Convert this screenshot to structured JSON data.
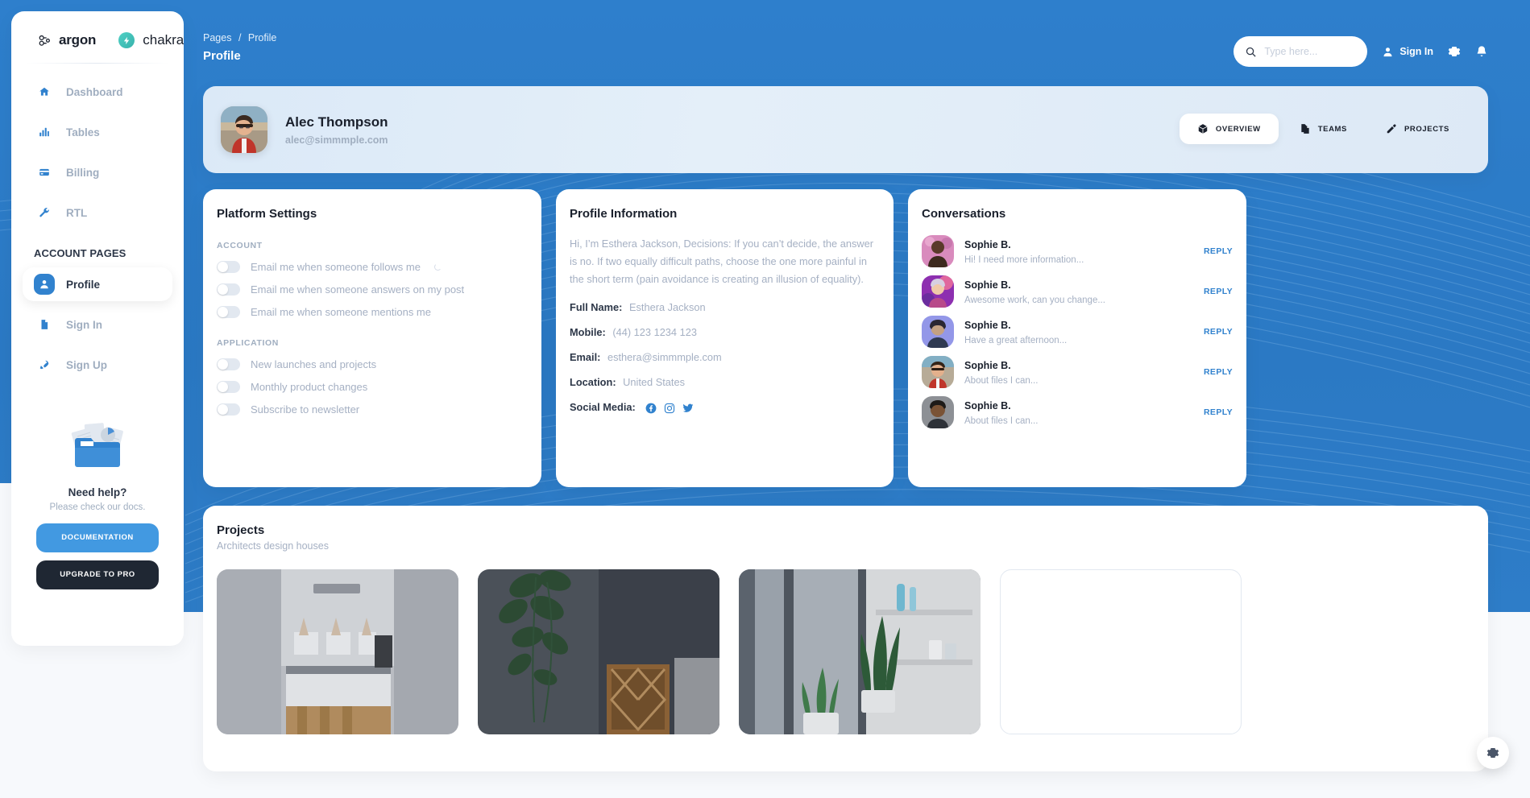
{
  "brand": {
    "name": "argon",
    "sub": "chakra"
  },
  "sidebar": {
    "items": [
      {
        "label": "Dashboard",
        "icon": "home-icon",
        "active": false
      },
      {
        "label": "Tables",
        "icon": "chart-bars-icon",
        "active": false
      },
      {
        "label": "Billing",
        "icon": "credit-card-icon",
        "active": false
      },
      {
        "label": "RTL",
        "icon": "wrench-icon",
        "active": false
      }
    ],
    "section_label": "ACCOUNT PAGES",
    "account_items": [
      {
        "label": "Profile",
        "icon": "person-icon",
        "active": true
      },
      {
        "label": "Sign In",
        "icon": "document-icon",
        "active": false
      },
      {
        "label": "Sign Up",
        "icon": "rocket-icon",
        "active": false
      }
    ],
    "help": {
      "title": "Need help?",
      "subtitle": "Please check our docs.",
      "doc_button": "DOCUMENTATION",
      "pro_button": "UPGRADE TO PRO"
    }
  },
  "topbar": {
    "breadcrumb_parent": "Pages",
    "breadcrumb_sep": "/",
    "breadcrumb_current": "Profile",
    "page_title": "Profile",
    "search_placeholder": "Type here...",
    "search_value": "",
    "sign_in": "Sign In",
    "icons": [
      "search-icon",
      "person-icon",
      "gear-icon",
      "bell-icon"
    ]
  },
  "profile_header": {
    "name": "Alec Thompson",
    "email": "alec@simmmple.com",
    "tabs": [
      {
        "label": "OVERVIEW",
        "icon": "cube-icon",
        "active": true
      },
      {
        "label": "TEAMS",
        "icon": "documents-icon",
        "active": false
      },
      {
        "label": "PROJECTS",
        "icon": "pen-icon",
        "active": false
      }
    ]
  },
  "platform_settings": {
    "title": "Platform Settings",
    "groups": [
      {
        "label": "ACCOUNT",
        "items": [
          {
            "label": "Email me when someone follows me",
            "on": false,
            "spinner": true
          },
          {
            "label": "Email me when someone answers on my post",
            "on": false,
            "spinner": false
          },
          {
            "label": "Email me when someone mentions me",
            "on": false,
            "spinner": false
          }
        ]
      },
      {
        "label": "APPLICATION",
        "items": [
          {
            "label": "New launches and projects",
            "on": false,
            "spinner": false
          },
          {
            "label": "Monthly product changes",
            "on": false,
            "spinner": false
          },
          {
            "label": "Subscribe to newsletter",
            "on": false,
            "spinner": false
          }
        ]
      }
    ]
  },
  "profile_information": {
    "title": "Profile Information",
    "bio": "Hi, I’m Esthera Jackson, Decisions: If you can’t decide, the answer is no. If two equally difficult paths, choose the one more painful in the short term (pain avoidance is creating an illusion of equality).",
    "fields": [
      {
        "key": "Full Name:",
        "value": "Esthera Jackson"
      },
      {
        "key": "Mobile:",
        "value": "(44) 123 1234 123"
      },
      {
        "key": "Email:",
        "value": "esthera@simmmple.com"
      },
      {
        "key": "Location:",
        "value": "United States"
      }
    ],
    "social_label": "Social Media:",
    "socials": [
      "facebook-icon",
      "instagram-icon",
      "twitter-icon"
    ]
  },
  "conversations": {
    "title": "Conversations",
    "reply_label": "REPLY",
    "items": [
      {
        "name": "Sophie B.",
        "message": "Hi! I need more information...",
        "avatar_colors": [
          "#d98bbd",
          "#7a3f63"
        ]
      },
      {
        "name": "Sophie B.",
        "message": "Awesome work, can you change...",
        "avatar_colors": [
          "#b44ad6",
          "#e0679e"
        ]
      },
      {
        "name": "Sophie B.",
        "message": "Have a great afternoon...",
        "avatar_colors": [
          "#8f93e8",
          "#5f6bc4"
        ]
      },
      {
        "name": "Sophie B.",
        "message": "About files I can...",
        "avatar_colors": [
          "#cf3f34",
          "#8aa3b8"
        ]
      },
      {
        "name": "Sophie B.",
        "message": "About files I can...",
        "avatar_colors": [
          "#6b6f74",
          "#3c3f44"
        ]
      }
    ]
  },
  "projects": {
    "title": "Projects",
    "subtitle": "Architects design houses",
    "thumbnails": [
      {
        "name": "kitchen-interior",
        "colors": [
          "#b9bcc2",
          "#8f939b"
        ]
      },
      {
        "name": "plant-room-interior",
        "colors": [
          "#4b5159",
          "#2f343b"
        ]
      },
      {
        "name": "shelf-plants-interior",
        "colors": [
          "#7d858f",
          "#4b5159"
        ]
      }
    ],
    "empty_slot": true
  },
  "fab": {
    "icon": "gear-icon"
  },
  "colors": {
    "brand_blue": "#3182ce",
    "page_blue": "#2e7fcc",
    "dark": "#1f2733",
    "muted": "#a0aec0",
    "card_bg": "#ffffff"
  }
}
